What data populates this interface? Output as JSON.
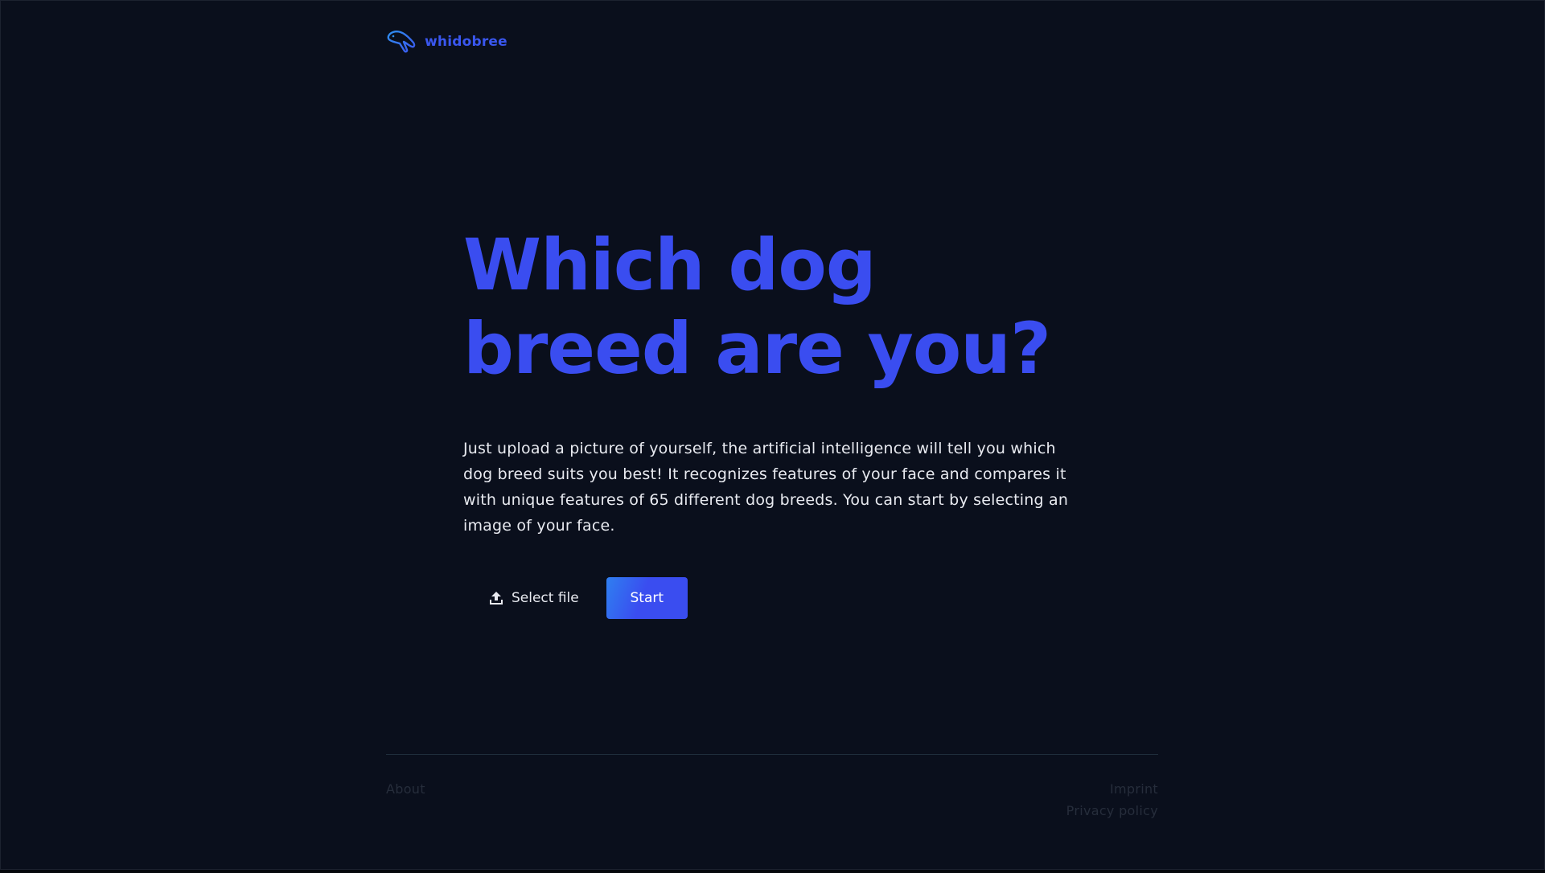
{
  "header": {
    "brand_name": "whidobree",
    "logo_icon": "dog-head-outline-icon"
  },
  "hero": {
    "title_line1": "Which dog",
    "title_line2": "breed are you?",
    "description": "Just upload a picture of yourself, the artificial intelligence will tell you which dog breed suits you best! It recognizes features of your face and compares it with unique features of 65 different dog breeds. You can start by selecting an image of your face."
  },
  "actions": {
    "select_file_label": "Select file",
    "select_file_icon": "upload-icon",
    "start_label": "Start"
  },
  "footer": {
    "about": "About",
    "imprint": "Imprint",
    "privacy": "Privacy policy"
  },
  "colors": {
    "background": "#0a0f1c",
    "accent": "#3a4df0",
    "accent_gradient_start": "#2f7ff0",
    "text": "#e8eaf0",
    "footer_text": "#262d3b"
  }
}
